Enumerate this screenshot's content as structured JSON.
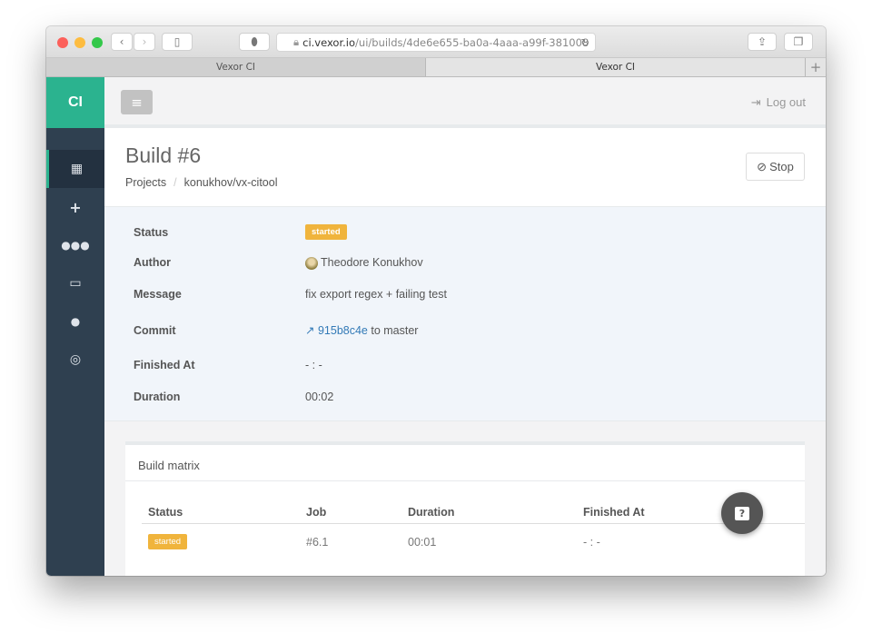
{
  "browser": {
    "url_host": "ci.vexor.io",
    "url_path": "/ui/builds/4de6e655-ba0a-4aaa-a99f-381008",
    "tabs": [
      {
        "label": "Vexor CI"
      },
      {
        "label": "Vexor CI"
      }
    ],
    "new_tab": "+"
  },
  "sidebar": {
    "logo": "CI",
    "items": [
      {
        "icon": "dashboard-icon",
        "glyph": "▪▪"
      },
      {
        "icon": "plus-icon",
        "glyph": "+"
      },
      {
        "icon": "users-icon",
        "glyph": "👥"
      },
      {
        "icon": "credit-card-icon",
        "glyph": "▭"
      },
      {
        "icon": "user-icon",
        "glyph": "👤"
      },
      {
        "icon": "support-icon",
        "glyph": "◎"
      }
    ],
    "accent": "#2bb38f"
  },
  "topbar": {
    "menu_glyph": "≡",
    "logout": "Log out"
  },
  "header": {
    "title": "Build #6",
    "breadcrumb": [
      "Projects",
      "konukhov/vx-citool"
    ],
    "stop": "Stop"
  },
  "details": {
    "status_label": "Status",
    "status": "started",
    "author_label": "Author",
    "author": "Theodore Konukhov",
    "message_label": "Message",
    "message": "fix export regex + failing test",
    "commit_label": "Commit",
    "commit_sha": "915b8c4e",
    "commit_branch": "to master",
    "finished_label": "Finished At",
    "finished": "- : -",
    "duration_label": "Duration",
    "duration": "00:02"
  },
  "matrix": {
    "title": "Build matrix",
    "columns": [
      "Status",
      "Job",
      "Duration",
      "Finished At"
    ],
    "rows": [
      {
        "status": "started",
        "job": "#6.1",
        "duration": "00:01",
        "finished": "- : -"
      }
    ]
  },
  "help": "?",
  "colors": {
    "badge": "#f0b43c",
    "sidebar": "#2f4050",
    "link": "#337ab7"
  }
}
